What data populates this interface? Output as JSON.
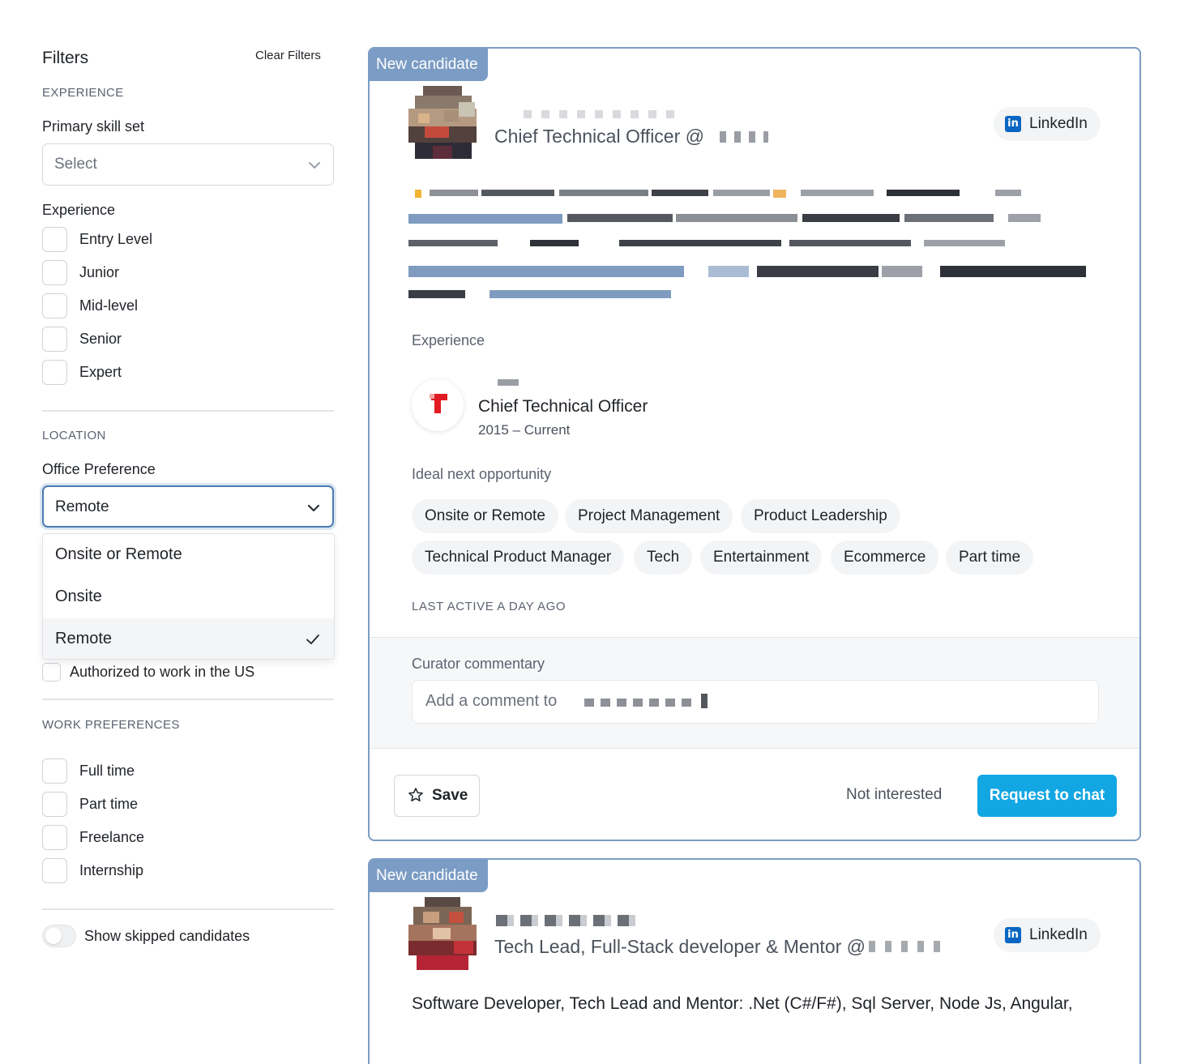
{
  "sidebar": {
    "title": "Filters",
    "clear_label": "Clear Filters",
    "experience_section": "EXPERIENCE",
    "primary_skill_label": "Primary skill set",
    "primary_skill_placeholder": "Select",
    "experience_label": "Experience",
    "experience_levels": [
      "Entry Level",
      "Junior",
      "Mid-level",
      "Senior",
      "Expert"
    ],
    "location_section": "LOCATION",
    "office_pref_label": "Office Preference",
    "office_pref_value": "Remote",
    "office_options": [
      "Onsite or Remote",
      "Onsite",
      "Remote"
    ],
    "office_selected": "Remote",
    "authorized_label": "Authorized to work in the US",
    "work_pref_section": "WORK PREFERENCES",
    "work_prefs": [
      "Full time",
      "Part time",
      "Freelance",
      "Internship"
    ],
    "show_skipped_label": "Show skipped candidates",
    "show_skipped": false
  },
  "candidates": [
    {
      "badge": "New candidate",
      "role": "Chief Technical Officer @",
      "linkedin_label": "LinkedIn",
      "experience_title": "Experience",
      "experience": {
        "title": "Chief Technical Officer",
        "dates": "2015 – Current"
      },
      "ideal_title": "Ideal next opportunity",
      "chips": [
        "Onsite or Remote",
        "Project Management",
        "Product Leadership",
        "Technical Product Manager",
        "Tech",
        "Entertainment",
        "Ecommerce",
        "Part time"
      ],
      "last_active": "LAST ACTIVE A DAY AGO",
      "commentary_title": "Curator commentary",
      "comment_placeholder": "Add a comment to",
      "save_label": "Save",
      "not_interested_label": "Not interested",
      "request_label": "Request to chat"
    },
    {
      "badge": "New candidate",
      "role": "Tech Lead, Full-Stack developer & Mentor @",
      "linkedin_label": "LinkedIn",
      "summary": "Software Developer, Tech Lead and Mentor: .Net (C#/F#), Sql Server, Node Js, Angular,"
    }
  ],
  "colors": {
    "accent_border": "#7b9cc4",
    "request_button": "#12a6e3",
    "linkedin": "#0a66c2"
  }
}
